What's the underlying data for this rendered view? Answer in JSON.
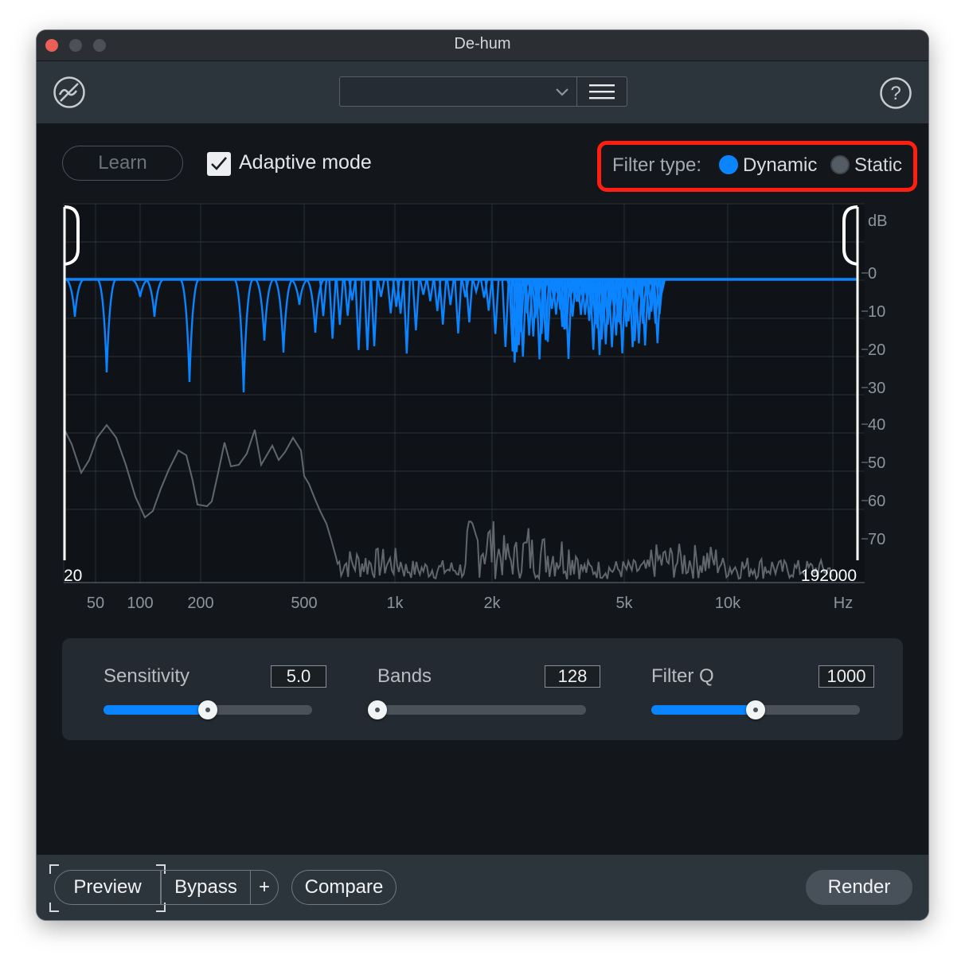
{
  "window": {
    "title": "De-hum",
    "colors": {
      "accent": "#0b84ff",
      "highlight": "#ff1e10",
      "background": "#13171b"
    }
  },
  "toolbar": {
    "preset_value": "",
    "logo_icon": "dehum-logo-icon",
    "menu_icon": "hamburger-menu-icon",
    "help_icon": "help-icon",
    "help_glyph": "?"
  },
  "top_controls": {
    "learn_label": "Learn",
    "adaptive_checked": true,
    "adaptive_label": "Adaptive mode",
    "filter_type_label": "Filter type:",
    "filter_options": [
      "Dynamic",
      "Static"
    ],
    "filter_selected": "Dynamic"
  },
  "graph": {
    "db_unit": "dB",
    "db_ticks": [
      "0",
      "10",
      "20",
      "30",
      "40",
      "50",
      "60",
      "70"
    ],
    "freq_ticks": [
      "50",
      "100",
      "200",
      "500",
      "1k",
      "2k",
      "5k",
      "10k",
      "Hz"
    ],
    "range_low": "20",
    "range_high": "192000"
  },
  "controls": {
    "sensitivity": {
      "label": "Sensitivity",
      "value": "5.0",
      "fraction": 0.5
    },
    "bands": {
      "label": "Bands",
      "value": "128",
      "fraction": 0.0
    },
    "filter_q": {
      "label": "Filter Q",
      "value": "1000",
      "fraction": 0.5
    }
  },
  "bottom": {
    "preview_label": "Preview",
    "bypass_label": "Bypass",
    "plus_label": "+",
    "compare_label": "Compare",
    "render_label": "Render"
  }
}
